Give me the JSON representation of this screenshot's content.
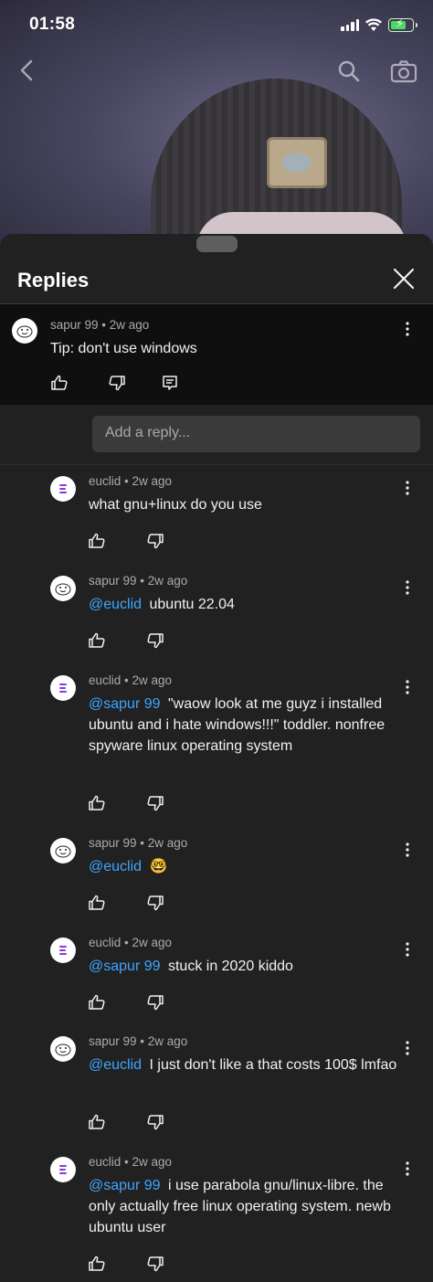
{
  "status_bar": {
    "time": "01:58"
  },
  "sheet": {
    "title": "Replies",
    "reply_placeholder": "Add a reply..."
  },
  "parent": {
    "author": "sapur 99",
    "age": "2w ago",
    "text": "Tip: don't use windows",
    "avatar": "snowman"
  },
  "replies": [
    {
      "author": "euclid",
      "age": "2w ago",
      "mention": "",
      "text": "what gnu+linux do you use",
      "avatar": "euclid"
    },
    {
      "author": "sapur 99",
      "age": "2w ago",
      "mention": "@euclid",
      "text": "ubuntu 22.04",
      "avatar": "snowman"
    },
    {
      "author": "euclid",
      "age": "2w ago",
      "mention": "@sapur 99",
      "text": "\"waow look at me guyz i installed ubuntu and i hate windows!!!\" toddler. nonfree spyware linux operating system",
      "avatar": "euclid"
    },
    {
      "author": "sapur 99",
      "age": "2w ago",
      "mention": "@euclid",
      "text": "🤓",
      "avatar": "snowman"
    },
    {
      "author": "euclid",
      "age": "2w ago",
      "mention": "@sapur 99",
      "text": "stuck in 2020 kiddo",
      "avatar": "euclid"
    },
    {
      "author": "sapur 99",
      "age": "2w ago",
      "mention": "@euclid",
      "text": "I just don't like a that costs 100$ lmfao",
      "avatar": "snowman"
    },
    {
      "author": "euclid",
      "age": "2w ago",
      "mention": "@sapur 99",
      "text": "i use parabola gnu/linux-libre. the only actually free linux operating system. newb ubuntu user",
      "avatar": "euclid"
    }
  ],
  "icons": {
    "back": "chevron-left-icon",
    "search": "search-icon",
    "camera": "camera-icon",
    "close": "close-icon",
    "like": "thumbs-up-icon",
    "dislike": "thumbs-down-icon",
    "reply": "reply-icon",
    "more": "more-vert-icon"
  },
  "colors": {
    "background": "#212121",
    "parent_bg": "#0f0f0f",
    "mention": "#3ea6ff",
    "meta": "#aaaaaa"
  }
}
